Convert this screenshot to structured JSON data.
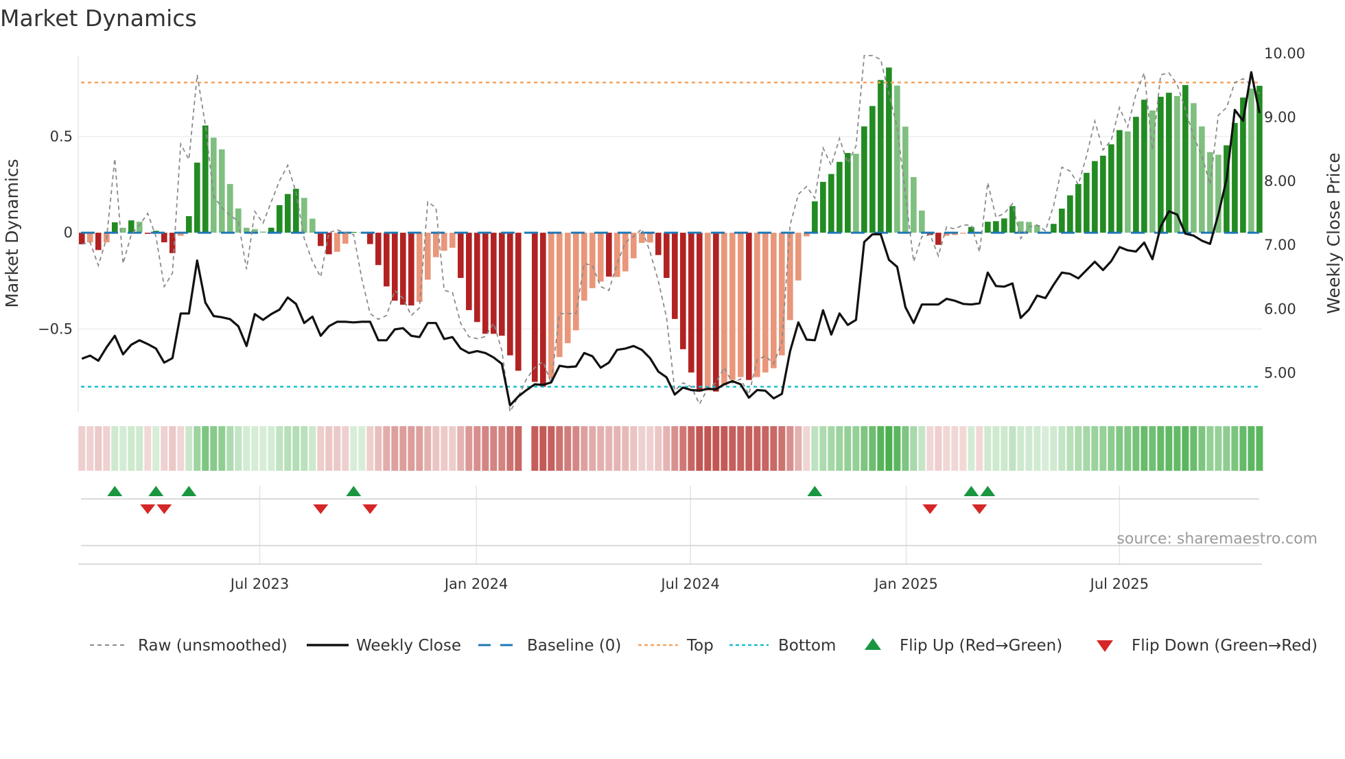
{
  "chart_data": {
    "type": "bar",
    "title": "Market Dynamics",
    "ylabel": "Market Dynamics",
    "ylabel_right": "Weekly Close Price",
    "source": "source: sharemaestro.com",
    "frequency": "weekly",
    "x_domain_weeks": [
      -0.44,
      143.3
    ],
    "ylim": [
      -0.93,
      0.92
    ],
    "ylim_right": [
      4.39,
      9.97
    ],
    "yticks": [
      {
        "value": 0.5,
        "label": "0.5"
      },
      {
        "value": 0,
        "label": "0"
      },
      {
        "value": -0.5,
        "label": "−0.5"
      }
    ],
    "yticks_right": [
      {
        "value": 10,
        "label": "10.00"
      },
      {
        "value": 9,
        "label": "9.00"
      },
      {
        "value": 8,
        "label": "8.00"
      },
      {
        "value": 7,
        "label": "7.00"
      },
      {
        "value": 6,
        "label": "6.00"
      },
      {
        "value": 5,
        "label": "5.00"
      }
    ],
    "xticks": [
      {
        "week": 21.6,
        "label": "Jul 2023"
      },
      {
        "week": 47.9,
        "label": "Jan 2024"
      },
      {
        "week": 73.9,
        "label": "Jul 2024"
      },
      {
        "week": 100.1,
        "label": "Jan 2025"
      },
      {
        "week": 126.0,
        "label": "Jul 2025"
      }
    ],
    "baseline": 0,
    "top": 0.78,
    "bottom": -0.8,
    "momentum": [
      -0.06,
      -0.05,
      -0.09,
      -0.05,
      0.054,
      0.026,
      0.064,
      0.057,
      -0.006,
      0.01,
      -0.05,
      -0.106,
      -0.016,
      0.086,
      0.364,
      0.557,
      0.494,
      0.433,
      0.253,
      0.126,
      0.026,
      0.019,
      0.006,
      0.026,
      0.143,
      0.201,
      0.228,
      0.181,
      0.073,
      -0.069,
      -0.112,
      -0.099,
      -0.057,
      0.004,
      0.002,
      -0.059,
      -0.168,
      -0.279,
      -0.353,
      -0.374,
      -0.378,
      -0.359,
      -0.244,
      -0.127,
      -0.094,
      -0.078,
      -0.235,
      -0.402,
      -0.464,
      -0.525,
      -0.525,
      -0.535,
      -0.637,
      -0.717,
      null,
      -0.775,
      -0.8,
      -0.757,
      -0.646,
      -0.574,
      -0.507,
      -0.353,
      -0.288,
      -0.254,
      -0.228,
      -0.23,
      -0.201,
      -0.133,
      -0.053,
      -0.051,
      -0.116,
      -0.235,
      -0.448,
      -0.605,
      -0.726,
      -0.825,
      -0.82,
      -0.825,
      -0.794,
      -0.765,
      -0.75,
      -0.765,
      -0.75,
      -0.726,
      -0.704,
      -0.637,
      -0.454,
      -0.248,
      -0.019,
      0.163,
      0.264,
      0.305,
      0.368,
      0.414,
      0.41,
      0.552,
      0.658,
      0.793,
      0.858,
      0.764,
      0.551,
      0.289,
      0.115,
      -0.012,
      -0.063,
      -0.016,
      -0.012,
      -0.005,
      0.03,
      -0.003,
      0.057,
      0.06,
      0.074,
      0.138,
      0.059,
      0.056,
      0.04,
      0.003,
      0.046,
      0.125,
      0.194,
      0.253,
      0.311,
      0.372,
      0.4,
      0.459,
      0.533,
      0.526,
      0.602,
      0.691,
      0.635,
      0.706,
      0.727,
      0.71,
      0.767,
      0.673,
      0.552,
      0.419,
      0.405,
      0.454,
      0.57,
      0.702,
      0.749,
      0.763
    ],
    "shade": "DLDLDLDLDDDDLDDDLLLLLLLDDDDLLDDLLDLDDDDDDLLLLLDDDDDDDD-DDLLLLLLLDLLLLLDDDDDDLDLLLDLLLLLLLDDDDDLDDDDLLLLDDLLLDDDDDDLLLLDDDDDDDDDLDDLDDLDLLLLDDDLD",
    "raw": [
      -0.06,
      -0.05,
      -0.17,
      -0.03,
      0.385,
      -0.16,
      -0.01,
      0.04,
      0.1,
      -0.02,
      -0.28,
      -0.21,
      0.46,
      0.38,
      0.82,
      0.56,
      0.19,
      0.13,
      0.09,
      0.06,
      -0.19,
      0.11,
      0.05,
      0.16,
      0.27,
      0.35,
      0.21,
      -0.03,
      -0.15,
      -0.23,
      0,
      0.015,
      0,
      -0.01,
      -0.24,
      -0.42,
      -0.45,
      -0.43,
      -0.3,
      -0.34,
      -0.43,
      -0.39,
      0.16,
      0.13,
      -0.3,
      -0.31,
      -0.47,
      -0.54,
      -0.55,
      -0.54,
      -0.47,
      -0.61,
      -0.93,
      -0.85,
      -0.76,
      -0.7,
      -0.67,
      -0.78,
      -0.42,
      -0.42,
      -0.42,
      -0.16,
      -0.17,
      -0.28,
      -0.3,
      -0.16,
      -0.05,
      -0.02,
      0.02,
      -0.1,
      -0.25,
      -0.44,
      -0.82,
      -0.78,
      -0.8,
      -0.89,
      -0.81,
      -0.78,
      -0.7,
      -0.78,
      -0.76,
      -0.84,
      -0.66,
      -0.64,
      -0.68,
      -0.57,
      0.04,
      0.2,
      0.24,
      0.18,
      0.44,
      0.35,
      0.49,
      0.36,
      0.45,
      0.92,
      0.92,
      0.9,
      0.72,
      0.55,
      0.2,
      -0.15,
      -0.02,
      -0.01,
      -0.12,
      0.03,
      0.02,
      0.04,
      0.04,
      -0.1,
      0.26,
      0.08,
      0.1,
      0.15,
      -0.03,
      0.03,
      0.04,
      0.01,
      0.14,
      0.34,
      0.32,
      0.25,
      0.4,
      0.58,
      0.43,
      0.48,
      0.65,
      0.55,
      0.72,
      0.83,
      0.43,
      0.82,
      0.83,
      0.77,
      0.64,
      0.5,
      0.4,
      0.25,
      0.61,
      0.65,
      0.78,
      0.8,
      0.77,
      0.72
    ],
    "price": [
      5.22,
      5.27,
      5.19,
      5.4,
      5.58,
      5.29,
      5.44,
      5.51,
      5.45,
      5.38,
      5.16,
      5.23,
      5.93,
      5.93,
      6.76,
      6.1,
      5.89,
      5.87,
      5.84,
      5.73,
      5.42,
      5.92,
      5.83,
      5.92,
      5.99,
      6.18,
      6.08,
      5.78,
      5.88,
      5.58,
      5.73,
      5.8,
      5.8,
      5.79,
      5.8,
      5.8,
      5.51,
      5.51,
      5.68,
      5.7,
      5.58,
      5.56,
      5.78,
      5.78,
      5.53,
      5.56,
      5.38,
      5.31,
      5.34,
      5.31,
      5.24,
      5.14,
      4.49,
      4.63,
      4.73,
      4.82,
      4.81,
      4.85,
      5.11,
      5.09,
      5.1,
      5.31,
      5.26,
      5.08,
      5.16,
      5.36,
      5.38,
      5.42,
      5.36,
      5.23,
      5.02,
      4.93,
      4.66,
      4.77,
      4.73,
      4.72,
      4.75,
      4.74,
      4.82,
      4.87,
      4.82,
      4.61,
      4.73,
      4.72,
      4.6,
      4.67,
      5.34,
      5.79,
      5.52,
      5.51,
      5.98,
      5.6,
      5.93,
      5.75,
      5.83,
      7.05,
      7.17,
      7.17,
      6.77,
      6.66,
      6.03,
      5.78,
      6.07,
      6.07,
      6.07,
      6.16,
      6.13,
      6.08,
      6.07,
      6.09,
      6.57,
      6.36,
      6.35,
      6.4,
      5.86,
      5.99,
      6.21,
      6.17,
      6.38,
      6.57,
      6.55,
      6.48,
      6.61,
      6.74,
      6.61,
      6.75,
      6.97,
      6.92,
      6.9,
      7.04,
      6.78,
      7.29,
      7.53,
      7.48,
      7.18,
      7.15,
      7.07,
      7.02,
      7.48,
      8.03,
      9.12,
      8.95,
      9.71,
      9.07
    ],
    "flip_up_weeks": [
      4,
      9,
      13,
      33,
      89,
      108,
      110
    ],
    "flip_down_weeks": [
      8,
      10,
      29,
      35,
      103,
      109
    ],
    "colors": {
      "dark_green": "#228b22",
      "light_green": "#7fbf7f",
      "dark_red": "#b22222",
      "light_red": "#e9967a",
      "baseline": "#1f77b4",
      "top": "#f4a460",
      "bottom": "#17becf",
      "raw": "#8a8a8a",
      "price": "#111111",
      "flip_up": "#1a9641",
      "flip_down": "#d62728",
      "strip_green": "#4caf50",
      "strip_red": "#c0504d"
    },
    "legend": {
      "placement": "bottom",
      "items": [
        {
          "key": "raw",
          "label": "Raw (unsmoothed)"
        },
        {
          "key": "price",
          "label": "Weekly Close"
        },
        {
          "key": "baseline",
          "label": "Baseline (0)"
        },
        {
          "key": "top",
          "label": "Top"
        },
        {
          "key": "bottom",
          "label": "Bottom"
        },
        {
          "key": "flip_up",
          "label": "Flip Up (Red→Green)"
        },
        {
          "key": "flip_down",
          "label": "Flip Down (Green→Red)"
        }
      ]
    }
  }
}
